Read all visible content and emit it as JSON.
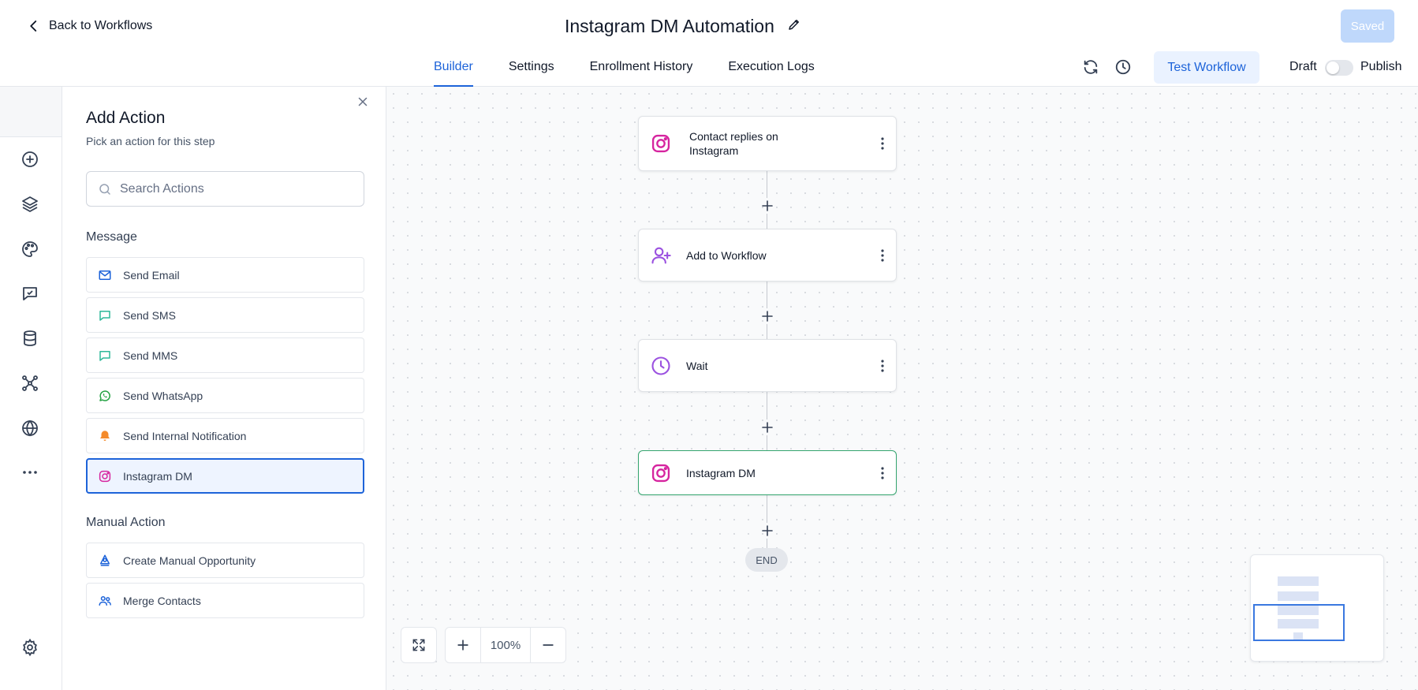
{
  "header": {
    "back_label": "Back to Workflows",
    "title": "Instagram DM Automation",
    "saved_label": "Saved",
    "tabs": [
      {
        "label": "Builder",
        "active": true
      },
      {
        "label": "Settings",
        "active": false
      },
      {
        "label": "Enrollment History",
        "active": false
      },
      {
        "label": "Execution Logs",
        "active": false
      }
    ],
    "icons": [
      "refresh-icon",
      "history-icon"
    ],
    "test_button": "Test Workflow",
    "draft_label": "Draft",
    "publish_label": "Publish",
    "publish_enabled": false
  },
  "rail": {
    "icons": [
      "add-circle-icon",
      "layers-icon",
      "palette-icon",
      "chat-icon",
      "database-icon",
      "graph-icon",
      "globe-icon",
      "more-icon",
      "settings-icon"
    ]
  },
  "panel": {
    "title": "Add Action",
    "subtitle": "Pick an action for this step",
    "search_placeholder": "Search Actions",
    "sections": [
      {
        "label": "Message",
        "items": [
          {
            "label": "Send Email",
            "icon": "mail-icon"
          },
          {
            "label": "Send SMS",
            "icon": "sms-icon"
          },
          {
            "label": "Send MMS",
            "icon": "mms-icon"
          },
          {
            "label": "Send WhatsApp",
            "icon": "whatsapp-icon"
          },
          {
            "label": "Send Internal Notification",
            "icon": "bell-icon"
          },
          {
            "label": "Instagram DM",
            "icon": "instagram-icon",
            "selected": true
          }
        ]
      },
      {
        "label": "Manual Action",
        "items": [
          {
            "label": "Create Manual Opportunity",
            "icon": "opportunity-icon"
          },
          {
            "label": "Merge Contacts",
            "icon": "users-icon"
          }
        ]
      }
    ]
  },
  "canvas": {
    "nodes": [
      {
        "line1": "Contact replies on",
        "line2": "Instagram",
        "icon": "instagram-icon"
      },
      {
        "label": "Add to Workflow",
        "icon": "user-plus-icon"
      },
      {
        "label": "Wait",
        "icon": "clock-icon"
      },
      {
        "label": "Instagram DM",
        "icon": "instagram-icon",
        "selected": true
      }
    ],
    "end_label": "END",
    "zoom": "100%"
  },
  "colors": {
    "accent": "#1d63d9",
    "selected_node_border": "#34a56f",
    "instagram": "#d6249f",
    "purple": "#9b51e0"
  }
}
